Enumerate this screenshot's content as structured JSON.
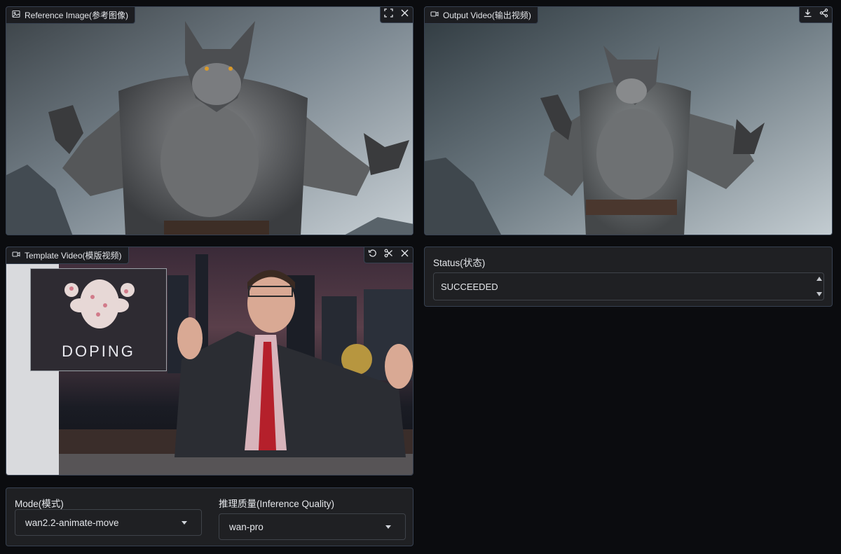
{
  "reference_panel": {
    "label": "Reference Image(参考图像)",
    "icon": "image-icon",
    "toolbar": [
      "fullscreen-icon",
      "close-icon"
    ]
  },
  "output_panel": {
    "label": "Output Video(输出视频)",
    "icon": "video-icon",
    "toolbar": [
      "download-icon",
      "share-icon"
    ]
  },
  "template_panel": {
    "label": "Template Video(模版视频)",
    "icon": "video-icon",
    "toolbar": [
      "undo-icon",
      "scissors-icon",
      "close-icon"
    ],
    "inset_text": "DOPING"
  },
  "status": {
    "label": "Status(状态)",
    "value": "SUCCEEDED"
  },
  "mode": {
    "label": "Mode(模式)",
    "value": "wan2.2-animate-move"
  },
  "quality": {
    "label": "推理质量(Inference Quality)",
    "value": "wan-pro"
  },
  "colors": {
    "background": "#0b0c0f",
    "panel": "#1f2023",
    "border": "#374151",
    "text": "#e5e7eb"
  }
}
